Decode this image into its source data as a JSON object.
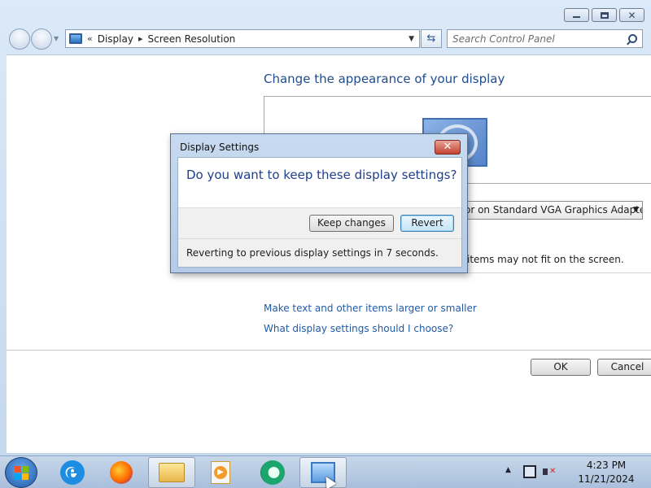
{
  "window": {
    "caption_buttons": [
      "minimize-icon",
      "maximize-icon",
      "close-icon"
    ]
  },
  "address_bar": {
    "overflow": "«",
    "crumbs": [
      "Display",
      "Screen Resolution"
    ],
    "separator": "▸"
  },
  "search": {
    "placeholder": "Search Control Panel"
  },
  "main": {
    "heading": "Change the appearance of your display",
    "adapter_value": "or on Standard VGA Graphics Adapter",
    "warning_text": "items may not fit on the screen.",
    "links": [
      "Make text and other items larger or smaller",
      "What display settings should I choose?"
    ],
    "ok_label": "OK",
    "cancel_label": "Cancel"
  },
  "dialog": {
    "title": "Display Settings",
    "question": "Do you want to keep these display settings?",
    "keep_label": "Keep changes",
    "revert_label": "Revert",
    "countdown_text": "Reverting to previous display settings in 7 seconds."
  },
  "taskbar": {
    "items": [
      "internet-explorer-icon",
      "firefox-icon",
      "file-explorer-icon",
      "media-center-icon",
      "media-player-icon",
      "control-panel-icon"
    ],
    "time": "4:23 PM",
    "date": "11/21/2024"
  },
  "colors": {
    "heading": "#1f4c8f",
    "link": "#1f5aa8",
    "dialog_question": "#1f3f8a"
  }
}
